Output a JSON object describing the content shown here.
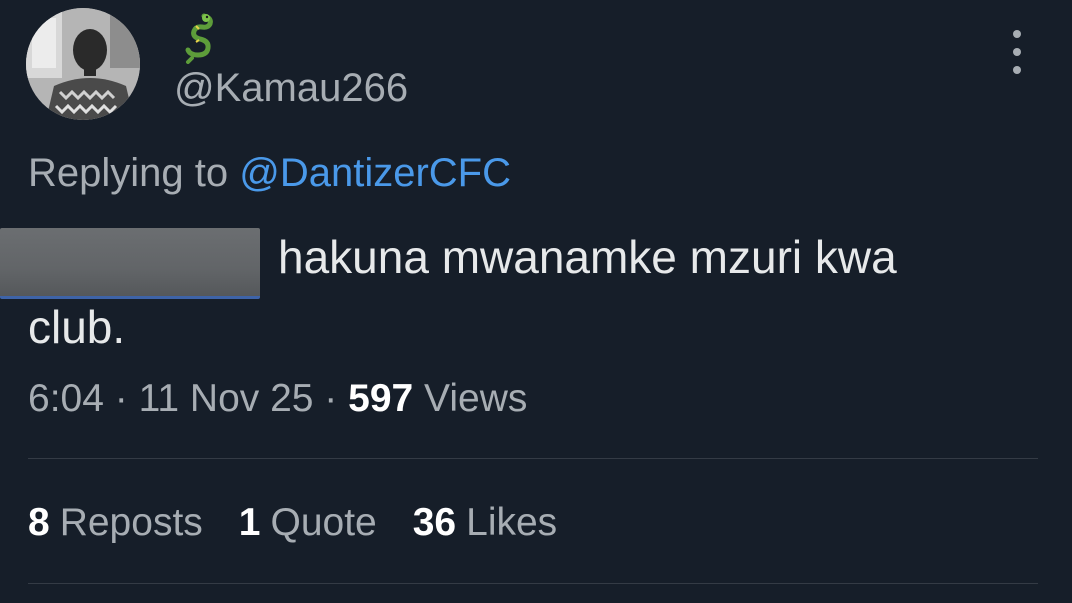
{
  "tweet": {
    "author": {
      "display_name_icon": "dragon-emoji-icon",
      "handle": "@Kamau266",
      "avatar": "profile-photo-avatar"
    },
    "more_icon": "more-vertical-icon",
    "reply": {
      "prefix": "Replying to ",
      "mention": "@DantizerCFC"
    },
    "text": {
      "line1": "hakuna mwanamke mzuri kwa",
      "line2": "club."
    },
    "meta": {
      "time": "6:04",
      "sep1": " · ",
      "date": "11 Nov 25",
      "sep2": " · ",
      "views_count": "597",
      "views_label": " Views"
    },
    "stats": {
      "reposts_count": "8",
      "reposts_label": "Reposts",
      "quotes_count": "1",
      "quotes_label": "Quote",
      "likes_count": "36",
      "likes_label": "Likes"
    }
  },
  "colors": {
    "background": "#161e29",
    "text": "#e7e9ea",
    "muted": "#a7adb3",
    "link": "#4a99e9"
  }
}
